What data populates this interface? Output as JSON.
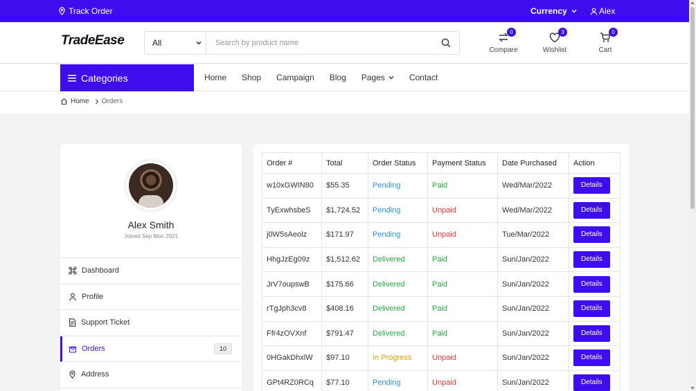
{
  "topbar": {
    "track_label": "Track Order",
    "currency_label": "Currency",
    "user_label": "Alex"
  },
  "header": {
    "logo": "TradeEase",
    "search": {
      "category": "All",
      "placeholder": "Search by product name"
    },
    "icons": [
      {
        "name": "compare",
        "label": "Compare",
        "badge": "0"
      },
      {
        "name": "wishlist",
        "label": "Wishlist",
        "badge": "3"
      },
      {
        "name": "cart",
        "label": "Cart",
        "badge": "0"
      }
    ]
  },
  "nav": {
    "categories_label": "Categories",
    "items": [
      "Home",
      "Shop",
      "Campaign",
      "Blog",
      "Pages",
      "Contact"
    ]
  },
  "breadcrumb": {
    "home": "Home",
    "current": "Orders"
  },
  "profile": {
    "name": "Alex Smith",
    "joined": "Joined Sep Mon 2021",
    "menu": [
      {
        "label": "Dashboard",
        "icon": "command-icon"
      },
      {
        "label": "Profile",
        "icon": "user-icon"
      },
      {
        "label": "Support Ticket",
        "icon": "document-icon"
      },
      {
        "label": "Orders",
        "icon": "bag-icon",
        "count": "10",
        "active": true
      },
      {
        "label": "Address",
        "icon": "location-pin-icon"
      }
    ]
  },
  "orders": {
    "columns": [
      "Order #",
      "Total",
      "Order Status",
      "Payment Status",
      "Date Purchased",
      "Action"
    ],
    "action_label": "Details",
    "rows": [
      {
        "id": "w10xGWIN80",
        "total": "$55.35",
        "status": "Pending",
        "payment": "Paid",
        "date": "Wed/Mar/2022"
      },
      {
        "id": "TyExwhsbeS",
        "total": "$1,724.52",
        "status": "Pending",
        "payment": "Unpaid",
        "date": "Wed/Mar/2022"
      },
      {
        "id": "j0W5sAeolz",
        "total": "$171.97",
        "status": "Pending",
        "payment": "Unpaid",
        "date": "Tue/Mar/2022"
      },
      {
        "id": "HhgJzEg09z",
        "total": "$1,512.62",
        "status": "Delivered",
        "payment": "Paid",
        "date": "Sun/Jan/2022"
      },
      {
        "id": "JrV7oupswB",
        "total": "$175.66",
        "status": "Delivered",
        "payment": "Paid",
        "date": "Sun/Jan/2022"
      },
      {
        "id": "rTgJph3cv8",
        "total": "$408.16",
        "status": "Delivered",
        "payment": "Paid",
        "date": "Sun/Jan/2022"
      },
      {
        "id": "Ffr4zOVXnf",
        "total": "$791.47",
        "status": "Delivered",
        "payment": "Paid",
        "date": "Sun/Jan/2022"
      },
      {
        "id": "0HGakDhxlW",
        "total": "$97.10",
        "status": "In Progress",
        "payment": "Unpaid",
        "date": "Sun/Jan/2022"
      },
      {
        "id": "GPt4RZ0RCq",
        "total": "$77.10",
        "status": "Pending",
        "payment": "Unpaid",
        "date": "Sun/Jan/2022"
      }
    ]
  },
  "colors": {
    "brand": "#3d0dee",
    "pending": "#2f8fe0",
    "delivered": "#28a745",
    "in_progress": "#f0a000",
    "unpaid": "#e53935"
  }
}
